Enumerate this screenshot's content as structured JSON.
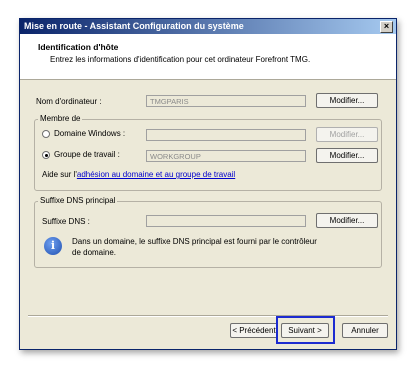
{
  "window": {
    "title": "Mise en route - Assistant Configuration du système",
    "close_label": "×"
  },
  "header": {
    "title": "Identification d'hôte",
    "subtitle": "Entrez les informations d'identification pour cet ordinateur Forefront TMG."
  },
  "computer_name": {
    "label": "Nom d'ordinateur :",
    "value": "TMGPARIS",
    "button": "Modifier..."
  },
  "member": {
    "legend": "Membre de",
    "domain_label": "Domaine Windows :",
    "domain_value": "",
    "domain_button": "Modifier...",
    "domain_selected": false,
    "workgroup_label": "Groupe de travail :",
    "workgroup_value": "WORKGROUP",
    "workgroup_button": "Modifier...",
    "workgroup_selected": true,
    "help_prefix": "Aide sur l'",
    "help_link": "adhésion au domaine et au groupe de travail"
  },
  "dns": {
    "legend": "Suffixe DNS principal",
    "label": "Suffixe DNS :",
    "value": "",
    "button": "Modifier...",
    "info_text_1": "Dans un domaine, le suffixe DNS principal est fourni par le contrôleur",
    "info_text_2": "de domaine.",
    "info_icon": "i"
  },
  "footer": {
    "back": "< Précédent",
    "next": "Suivant >",
    "cancel": "Annuler"
  },
  "colors": {
    "highlight": "#1c2bd0",
    "title_start": "#0a246a",
    "title_end": "#a6caf0",
    "dialog_bg": "#ece9d8"
  }
}
